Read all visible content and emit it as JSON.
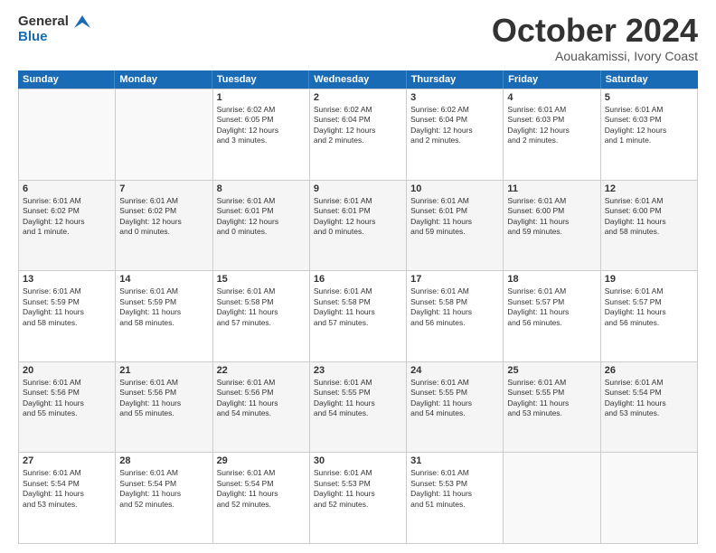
{
  "logo": {
    "line1": "General",
    "line2": "Blue"
  },
  "title": "October 2024",
  "subtitle": "Aouakamissi, Ivory Coast",
  "header_days": [
    "Sunday",
    "Monday",
    "Tuesday",
    "Wednesday",
    "Thursday",
    "Friday",
    "Saturday"
  ],
  "weeks": [
    [
      {
        "day": "",
        "info": ""
      },
      {
        "day": "",
        "info": ""
      },
      {
        "day": "1",
        "info": "Sunrise: 6:02 AM\nSunset: 6:05 PM\nDaylight: 12 hours\nand 3 minutes."
      },
      {
        "day": "2",
        "info": "Sunrise: 6:02 AM\nSunset: 6:04 PM\nDaylight: 12 hours\nand 2 minutes."
      },
      {
        "day": "3",
        "info": "Sunrise: 6:02 AM\nSunset: 6:04 PM\nDaylight: 12 hours\nand 2 minutes."
      },
      {
        "day": "4",
        "info": "Sunrise: 6:01 AM\nSunset: 6:03 PM\nDaylight: 12 hours\nand 2 minutes."
      },
      {
        "day": "5",
        "info": "Sunrise: 6:01 AM\nSunset: 6:03 PM\nDaylight: 12 hours\nand 1 minute."
      }
    ],
    [
      {
        "day": "6",
        "info": "Sunrise: 6:01 AM\nSunset: 6:02 PM\nDaylight: 12 hours\nand 1 minute."
      },
      {
        "day": "7",
        "info": "Sunrise: 6:01 AM\nSunset: 6:02 PM\nDaylight: 12 hours\nand 0 minutes."
      },
      {
        "day": "8",
        "info": "Sunrise: 6:01 AM\nSunset: 6:01 PM\nDaylight: 12 hours\nand 0 minutes."
      },
      {
        "day": "9",
        "info": "Sunrise: 6:01 AM\nSunset: 6:01 PM\nDaylight: 12 hours\nand 0 minutes."
      },
      {
        "day": "10",
        "info": "Sunrise: 6:01 AM\nSunset: 6:01 PM\nDaylight: 11 hours\nand 59 minutes."
      },
      {
        "day": "11",
        "info": "Sunrise: 6:01 AM\nSunset: 6:00 PM\nDaylight: 11 hours\nand 59 minutes."
      },
      {
        "day": "12",
        "info": "Sunrise: 6:01 AM\nSunset: 6:00 PM\nDaylight: 11 hours\nand 58 minutes."
      }
    ],
    [
      {
        "day": "13",
        "info": "Sunrise: 6:01 AM\nSunset: 5:59 PM\nDaylight: 11 hours\nand 58 minutes."
      },
      {
        "day": "14",
        "info": "Sunrise: 6:01 AM\nSunset: 5:59 PM\nDaylight: 11 hours\nand 58 minutes."
      },
      {
        "day": "15",
        "info": "Sunrise: 6:01 AM\nSunset: 5:58 PM\nDaylight: 11 hours\nand 57 minutes."
      },
      {
        "day": "16",
        "info": "Sunrise: 6:01 AM\nSunset: 5:58 PM\nDaylight: 11 hours\nand 57 minutes."
      },
      {
        "day": "17",
        "info": "Sunrise: 6:01 AM\nSunset: 5:58 PM\nDaylight: 11 hours\nand 56 minutes."
      },
      {
        "day": "18",
        "info": "Sunrise: 6:01 AM\nSunset: 5:57 PM\nDaylight: 11 hours\nand 56 minutes."
      },
      {
        "day": "19",
        "info": "Sunrise: 6:01 AM\nSunset: 5:57 PM\nDaylight: 11 hours\nand 56 minutes."
      }
    ],
    [
      {
        "day": "20",
        "info": "Sunrise: 6:01 AM\nSunset: 5:56 PM\nDaylight: 11 hours\nand 55 minutes."
      },
      {
        "day": "21",
        "info": "Sunrise: 6:01 AM\nSunset: 5:56 PM\nDaylight: 11 hours\nand 55 minutes."
      },
      {
        "day": "22",
        "info": "Sunrise: 6:01 AM\nSunset: 5:56 PM\nDaylight: 11 hours\nand 54 minutes."
      },
      {
        "day": "23",
        "info": "Sunrise: 6:01 AM\nSunset: 5:55 PM\nDaylight: 11 hours\nand 54 minutes."
      },
      {
        "day": "24",
        "info": "Sunrise: 6:01 AM\nSunset: 5:55 PM\nDaylight: 11 hours\nand 54 minutes."
      },
      {
        "day": "25",
        "info": "Sunrise: 6:01 AM\nSunset: 5:55 PM\nDaylight: 11 hours\nand 53 minutes."
      },
      {
        "day": "26",
        "info": "Sunrise: 6:01 AM\nSunset: 5:54 PM\nDaylight: 11 hours\nand 53 minutes."
      }
    ],
    [
      {
        "day": "27",
        "info": "Sunrise: 6:01 AM\nSunset: 5:54 PM\nDaylight: 11 hours\nand 53 minutes."
      },
      {
        "day": "28",
        "info": "Sunrise: 6:01 AM\nSunset: 5:54 PM\nDaylight: 11 hours\nand 52 minutes."
      },
      {
        "day": "29",
        "info": "Sunrise: 6:01 AM\nSunset: 5:54 PM\nDaylight: 11 hours\nand 52 minutes."
      },
      {
        "day": "30",
        "info": "Sunrise: 6:01 AM\nSunset: 5:53 PM\nDaylight: 11 hours\nand 52 minutes."
      },
      {
        "day": "31",
        "info": "Sunrise: 6:01 AM\nSunset: 5:53 PM\nDaylight: 11 hours\nand 51 minutes."
      },
      {
        "day": "",
        "info": ""
      },
      {
        "day": "",
        "info": ""
      }
    ]
  ]
}
